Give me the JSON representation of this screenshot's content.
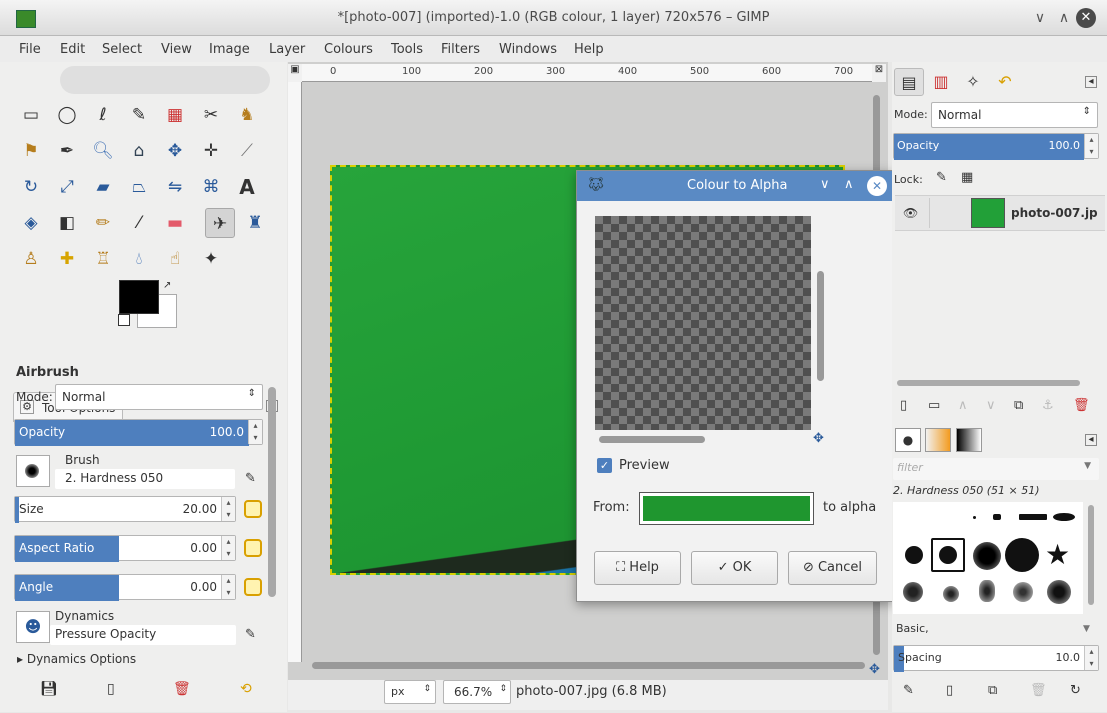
{
  "window": {
    "title": "*[photo-007] (imported)-1.0 (RGB colour, 1 layer) 720x576 – GIMP"
  },
  "menu": [
    "File",
    "Edit",
    "Select",
    "View",
    "Image",
    "Layer",
    "Colours",
    "Tools",
    "Filters",
    "Windows",
    "Help"
  ],
  "ruler": {
    "ticks": [
      "0",
      "100",
      "200",
      "300",
      "400",
      "500",
      "600",
      "700"
    ]
  },
  "tool_options": {
    "tab_label": "Tool Options",
    "tool_name": "Airbrush",
    "mode_label": "Mode:",
    "mode_value": "Normal",
    "opacity_label": "Opacity",
    "opacity_value": "100.0",
    "brush_label": "Brush",
    "brush_value": "2. Hardness 050",
    "size_label": "Size",
    "size_value": "20.00",
    "aspect_label": "Aspect Ratio",
    "aspect_value": "0.00",
    "angle_label": "Angle",
    "angle_value": "0.00",
    "dynamics_label": "Dynamics",
    "dynamics_value": "Pressure Opacity",
    "dynamics_options": "Dynamics Options"
  },
  "status": {
    "unit": "px",
    "zoom": "66.7%",
    "file": "photo-007.jpg (6.8 MB)"
  },
  "dialog": {
    "title": "Colour to Alpha",
    "preview_label": "Preview",
    "from_label": "From:",
    "to_alpha_label": "to alpha",
    "from_color": "#1f962f",
    "help": "Help",
    "ok": "OK",
    "cancel": "Cancel"
  },
  "layers": {
    "mode_label": "Mode:",
    "mode_value": "Normal",
    "opacity_label": "Opacity",
    "opacity_value": "100.0",
    "lock_label": "Lock:",
    "layer_name": "photo-007.jp"
  },
  "brushes": {
    "filter_placeholder": "filter",
    "current": "2. Hardness 050 (51 × 51)",
    "preset": "Basic,",
    "spacing_label": "Spacing",
    "spacing_value": "10.0"
  },
  "colors": {
    "accent": "#4e7fbe",
    "image_green": "#22a038"
  }
}
